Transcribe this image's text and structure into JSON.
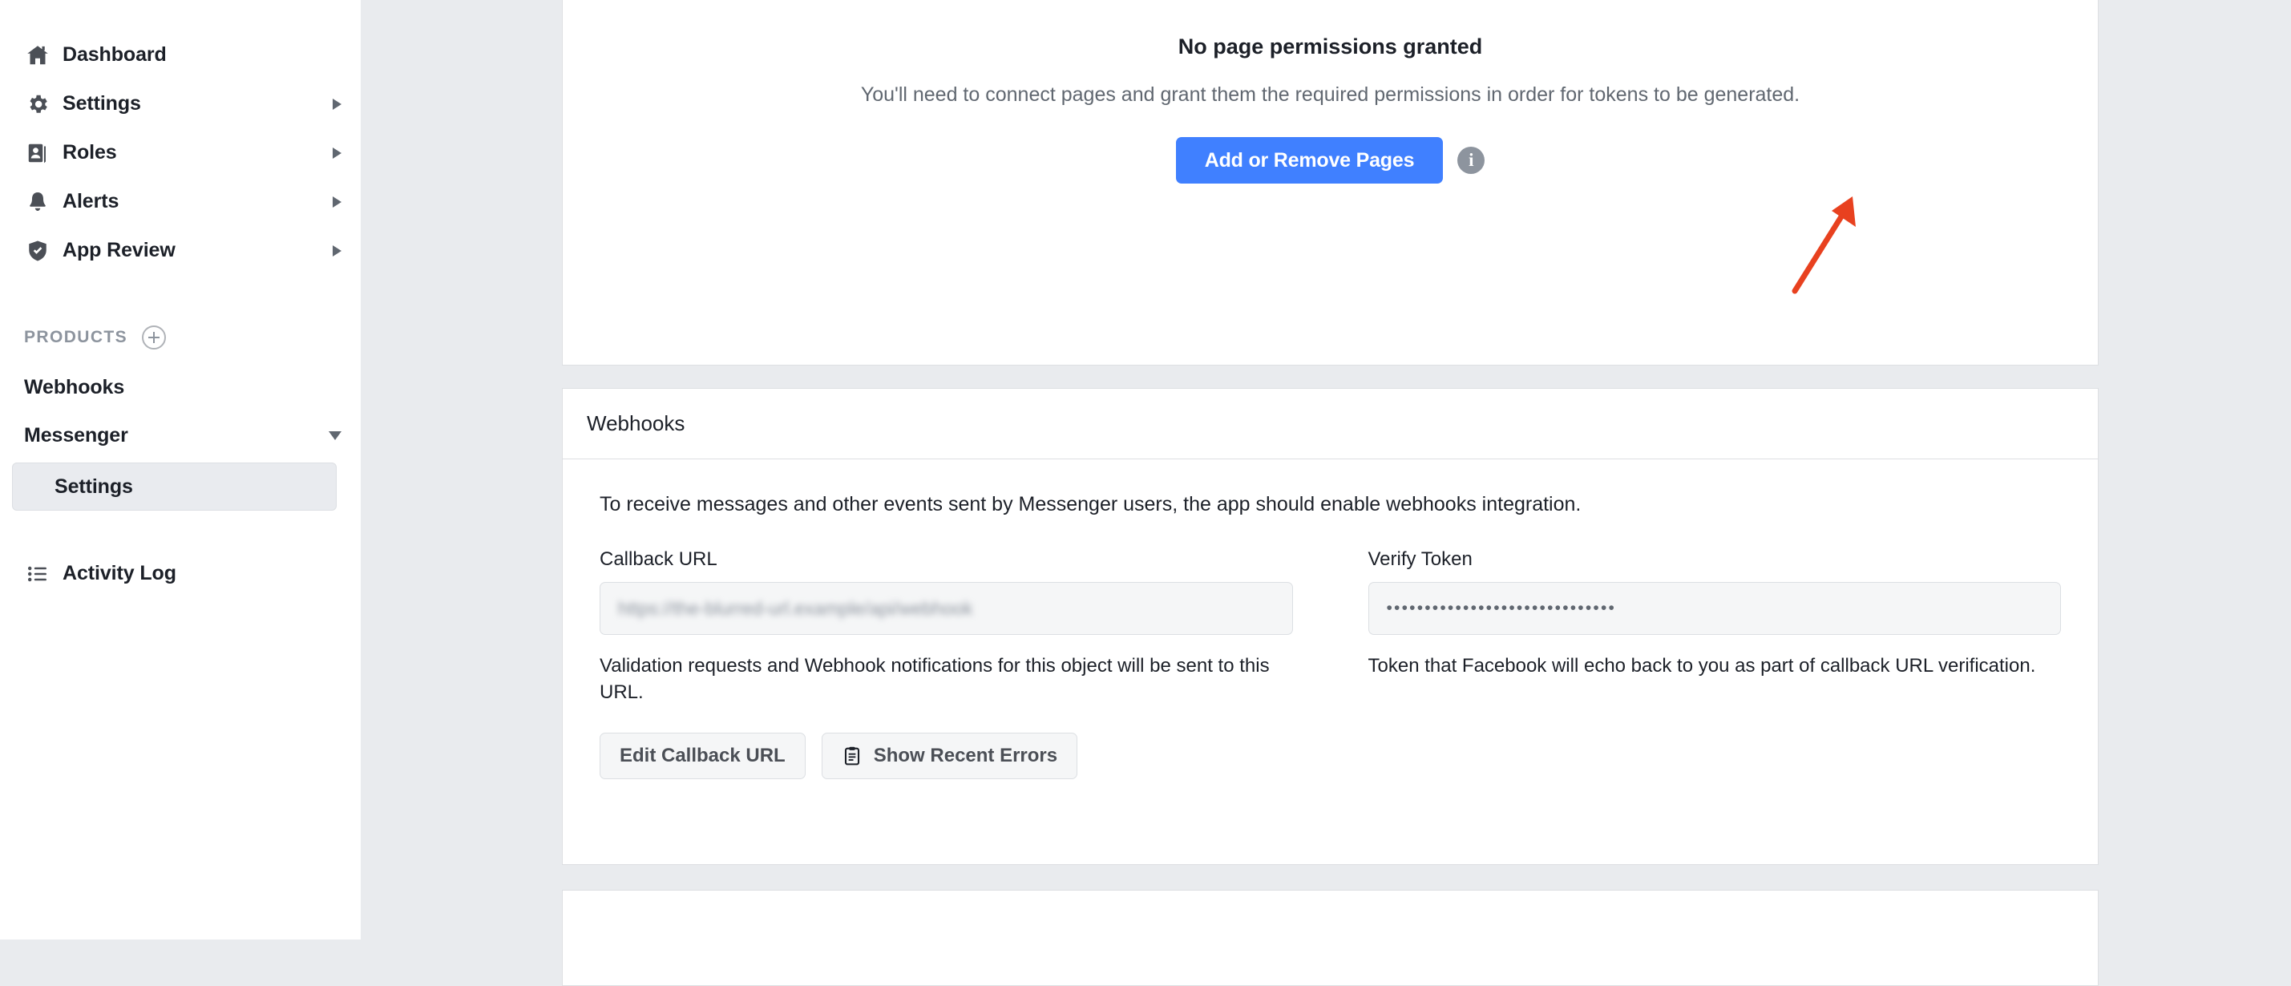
{
  "sidebar": {
    "nav_items": [
      {
        "label": "Dashboard",
        "icon": "home-icon",
        "has_caret": false
      },
      {
        "label": "Settings",
        "icon": "gear-icon",
        "has_caret": true
      },
      {
        "label": "Roles",
        "icon": "roles-icon",
        "has_caret": true
      },
      {
        "label": "Alerts",
        "icon": "bell-icon",
        "has_caret": true
      },
      {
        "label": "App Review",
        "icon": "shield-check-icon",
        "has_caret": true
      }
    ],
    "products_header": {
      "label": "PRODUCTS",
      "add_icon": "plus-circle-icon"
    },
    "products": [
      {
        "label": "Webhooks",
        "has_caret": false
      },
      {
        "label": "Messenger",
        "has_caret": true
      }
    ],
    "sub_items": [
      {
        "label": "Settings",
        "selected": true
      }
    ],
    "footer_items": [
      {
        "label": "Activity Log",
        "icon": "list-icon"
      }
    ]
  },
  "permissions_card": {
    "title": "No page permissions granted",
    "subtitle": "You'll need to connect pages and grant them the required permissions in order for tokens to be generated.",
    "primary_button": "Add or Remove Pages",
    "info_icon": "info-icon",
    "info_glyph": "i",
    "annotation": {
      "type": "arrow",
      "color": "#e8411f",
      "points_to": "Add or Remove Pages"
    }
  },
  "webhooks_card": {
    "header_title": "Webhooks",
    "intro": "To receive messages and other events sent by Messenger users, the app should enable webhooks integration.",
    "callback": {
      "label": "Callback URL",
      "value": "https://the-blurred-url.example/api/webhook",
      "redacted": true,
      "help": "Validation requests and Webhook notifications for this object will be sent to this URL."
    },
    "verify_token": {
      "label": "Verify Token",
      "value": "••••••••••••••••••••••••••••••",
      "masked": true,
      "help": "Token that Facebook will echo back to you as part of callback URL verification."
    },
    "buttons": [
      {
        "label": "Edit Callback URL",
        "icon": null
      },
      {
        "label": "Show Recent Errors",
        "icon": "clipboard-icon"
      }
    ]
  },
  "colors": {
    "page_background": "#e9ebee",
    "card_background": "#ffffff",
    "card_border": "#dddfe2",
    "primary_button": "#4080ff",
    "text_primary": "#1c2028",
    "text_secondary": "#606770",
    "muted": "#8d949e",
    "field_background": "#f5f6f7",
    "annotation": "#e8411f"
  }
}
